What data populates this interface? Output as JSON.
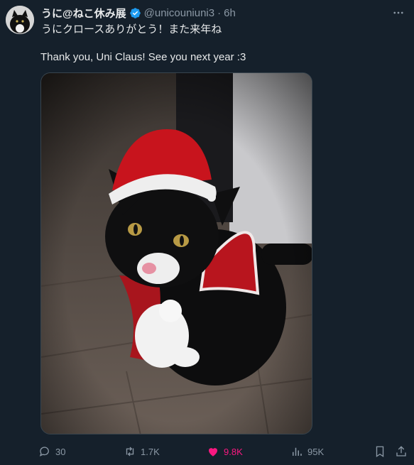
{
  "tweet": {
    "display_name": "うに@ねこ休み展",
    "handle": "@unicouniuni3",
    "separator": "·",
    "time": "6h",
    "text_jp": "うにクロースありがとう！また来年ね",
    "text_en": "Thank you, Uni Claus! See you next year :3"
  },
  "metrics": {
    "replies": "30",
    "retweets": "1.7K",
    "likes": "9.8K",
    "views": "95K"
  },
  "colors": {
    "background": "#15202b",
    "text": "#e7e9ea",
    "muted": "#8b98a5",
    "verified": "#1d9bf0",
    "like": "#f91880"
  },
  "icons": {
    "verified": "verified-badge-icon",
    "more": "more-options-icon",
    "reply": "reply-icon",
    "retweet": "retweet-icon",
    "like": "heart-icon",
    "views": "views-icon",
    "bookmark": "bookmark-icon",
    "share": "share-icon"
  }
}
